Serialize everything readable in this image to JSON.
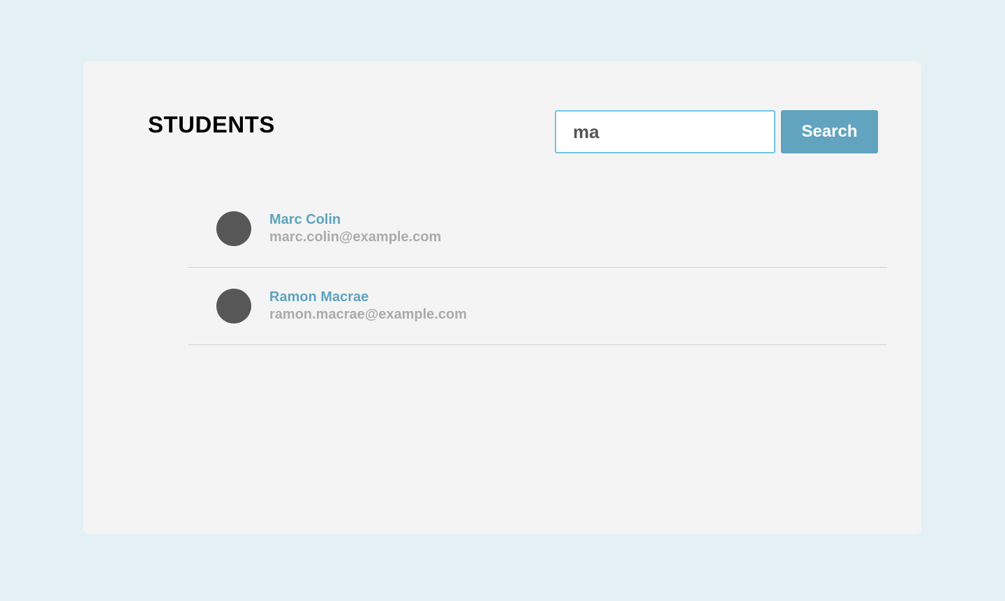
{
  "page": {
    "title": "STUDENTS"
  },
  "search": {
    "value": "ma",
    "button_label": "Search"
  },
  "students": [
    {
      "name": "Marc Colin",
      "email": "marc.colin@example.com"
    },
    {
      "name": "Ramon Macrae",
      "email": "ramon.macrae@example.com"
    }
  ],
  "colors": {
    "background": "#e3f0f6",
    "card": "#f4f4f4",
    "accent": "#62a4c0",
    "input_focus_border": "#71c3e6",
    "name_text": "#5fa3bf",
    "email_text": "#ababab",
    "avatar": "#575757"
  }
}
